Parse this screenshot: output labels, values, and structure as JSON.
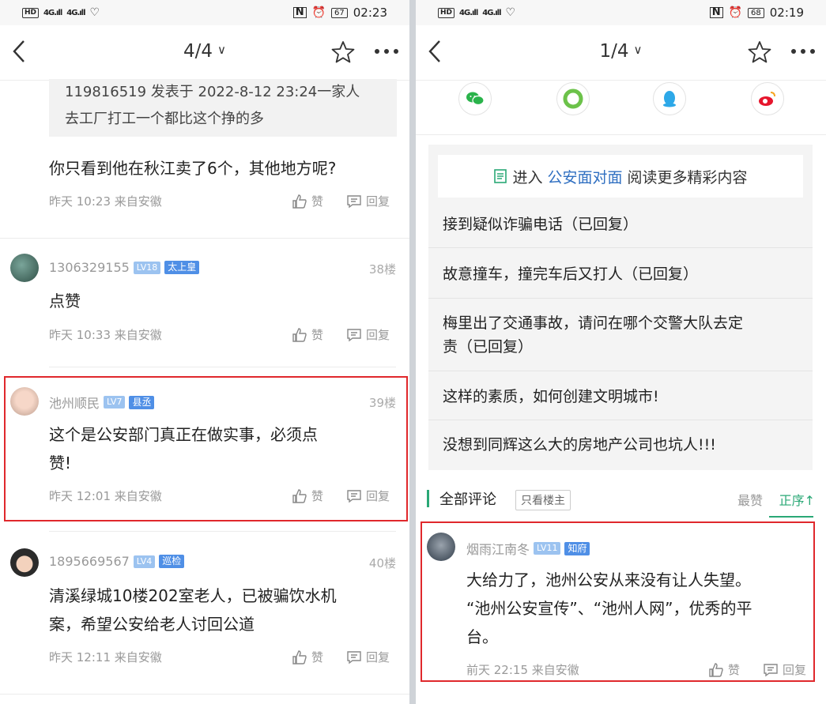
{
  "left": {
    "status": {
      "signal1": "4G",
      "signal2": "4G",
      "battery": "67",
      "time": "02:23"
    },
    "nav": {
      "page": "4/4"
    },
    "quote_lines": [
      "119816519 发表于 2022-8-12 23:24一家人",
      "去工厂打工一个都比这个挣的多"
    ],
    "reply_text": "你只看到他在秋江卖了6个，其他地方呢?",
    "reply_meta": "昨天 10:23 来自安徽",
    "like_label": "赞",
    "reply_label": "回复",
    "comments": [
      {
        "user": "1306329155",
        "level": "LV18",
        "title": "太上皇",
        "floor": "38楼",
        "lines": [
          "点赞"
        ],
        "meta": "昨天 10:33 来自安徽"
      },
      {
        "user": "池州顺民",
        "level": "LV7",
        "title": "县丞",
        "floor": "39楼",
        "lines": [
          "这个是公安部门真正在做实事，必须点",
          "赞!"
        ],
        "meta": "昨天 12:01 来自安徽"
      },
      {
        "user": "1895669567",
        "level": "LV4",
        "title": "巡检",
        "floor": "40楼",
        "lines": [
          "清溪绿城10楼202室老人，已被骗饮水机",
          "案，希望公安给老人讨回公道"
        ],
        "meta": "昨天 12:11 来自安徽"
      }
    ]
  },
  "right": {
    "status": {
      "signal1": "4G",
      "signal2": "4G",
      "battery": "68",
      "time": "02:19"
    },
    "nav": {
      "page": "1/4"
    },
    "share_icons": [
      "wechat-icon",
      "moments-icon",
      "qq-icon",
      "weibo-icon"
    ],
    "enter": {
      "prefix": "进入",
      "link": "公安面对面",
      "suffix": "阅读更多精彩内容"
    },
    "related": [
      [
        "接到疑似诈骗电话（已回复）"
      ],
      [
        "故意撞车，撞完车后又打人（已回复）"
      ],
      [
        "梅里出了交通事故，请问在哪个交警大队去定",
        "责（已回复）"
      ],
      [
        "这样的素质，如何创建文明城市!"
      ],
      [
        "没想到同辉这么大的房地产公司也坑人!!!"
      ]
    ],
    "tabs": {
      "all": "全部评论",
      "owner_only": "只看楼主",
      "hot": "最赞",
      "asc": "正序↑"
    },
    "comment": {
      "user": "烟雨江南冬",
      "level": "LV11",
      "title": "知府",
      "lines": [
        "大给力了，池州公安从来没有让人失望。",
        "“池州公安宣传”、“池州人网”，优秀的平",
        "台。"
      ],
      "meta": "前天 22:15 来自安徽"
    },
    "like_label": "赞",
    "reply_label": "回复"
  },
  "colors": {
    "accent_green": "#2aa876",
    "highlight_red": "#e0282c",
    "link_blue": "#2f6fc1"
  }
}
